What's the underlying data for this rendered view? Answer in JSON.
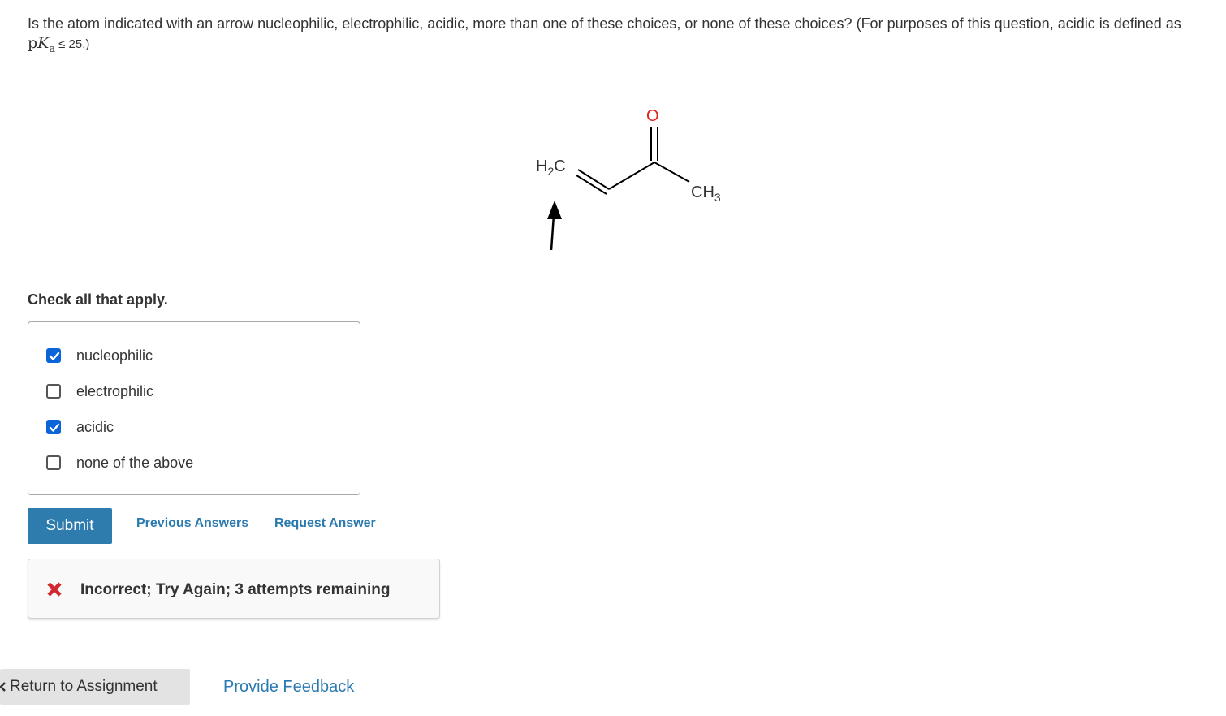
{
  "question": {
    "text": "Is the atom indicated with an arrow nucleophilic, electrophilic, acidic, more than one of these choices, or none of these choices? (For purposes of this question, acidic is defined as",
    "math_p": "p",
    "math_K": "K",
    "math_sub": "a",
    "math_rel": "≤ 25.)"
  },
  "molecule": {
    "left_group": "H2C",
    "left_group_main": "H",
    "left_group_sub": "2",
    "left_group_tail": "C",
    "top_atom": "O",
    "right_group_main": "CH",
    "right_group_sub": "3",
    "colors": {
      "bond": "#000000",
      "oxygen": "#e0221e",
      "arrow": "#000000"
    }
  },
  "instruction": "Check all that apply.",
  "options": [
    {
      "label": "nucleophilic",
      "checked": true
    },
    {
      "label": "electrophilic",
      "checked": false
    },
    {
      "label": "acidic",
      "checked": true
    },
    {
      "label": "none of the above",
      "checked": false
    }
  ],
  "actions": {
    "submit_label": "Submit",
    "previous_answers_label": "Previous Answers",
    "request_answer_label": "Request Answer"
  },
  "feedback": {
    "icon": "x-icon",
    "text": "Incorrect; Try Again; 3 attempts remaining",
    "color": "#d0282e"
  },
  "footer": {
    "return_label": "Return to Assignment",
    "return_icon": "chevron-left-icon",
    "provide_feedback_label": "Provide Feedback"
  },
  "colors": {
    "accent": "#2e7bae",
    "link": "#2a7ab0",
    "checkbox_checked": "#0b64d8"
  }
}
